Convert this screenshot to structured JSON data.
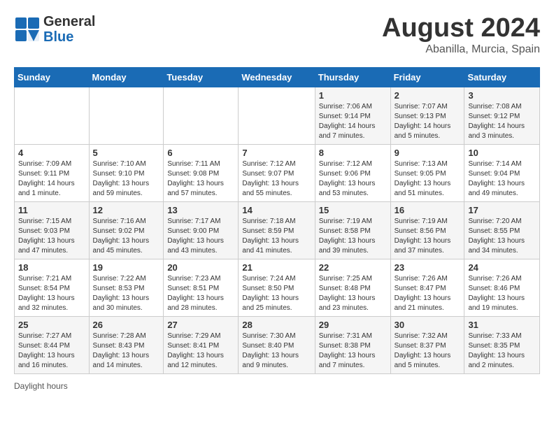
{
  "header": {
    "logo_general": "General",
    "logo_blue": "Blue",
    "month_year": "August 2024",
    "location": "Abanilla, Murcia, Spain"
  },
  "days_of_week": [
    "Sunday",
    "Monday",
    "Tuesday",
    "Wednesday",
    "Thursday",
    "Friday",
    "Saturday"
  ],
  "weeks": [
    [
      {
        "day": "",
        "sunrise": "",
        "sunset": "",
        "daylight": ""
      },
      {
        "day": "",
        "sunrise": "",
        "sunset": "",
        "daylight": ""
      },
      {
        "day": "",
        "sunrise": "",
        "sunset": "",
        "daylight": ""
      },
      {
        "day": "",
        "sunrise": "",
        "sunset": "",
        "daylight": ""
      },
      {
        "day": "1",
        "sunrise": "Sunrise: 7:06 AM",
        "sunset": "Sunset: 9:14 PM",
        "daylight": "Daylight: 14 hours and 7 minutes."
      },
      {
        "day": "2",
        "sunrise": "Sunrise: 7:07 AM",
        "sunset": "Sunset: 9:13 PM",
        "daylight": "Daylight: 14 hours and 5 minutes."
      },
      {
        "day": "3",
        "sunrise": "Sunrise: 7:08 AM",
        "sunset": "Sunset: 9:12 PM",
        "daylight": "Daylight: 14 hours and 3 minutes."
      }
    ],
    [
      {
        "day": "4",
        "sunrise": "Sunrise: 7:09 AM",
        "sunset": "Sunset: 9:11 PM",
        "daylight": "Daylight: 14 hours and 1 minute."
      },
      {
        "day": "5",
        "sunrise": "Sunrise: 7:10 AM",
        "sunset": "Sunset: 9:10 PM",
        "daylight": "Daylight: 13 hours and 59 minutes."
      },
      {
        "day": "6",
        "sunrise": "Sunrise: 7:11 AM",
        "sunset": "Sunset: 9:08 PM",
        "daylight": "Daylight: 13 hours and 57 minutes."
      },
      {
        "day": "7",
        "sunrise": "Sunrise: 7:12 AM",
        "sunset": "Sunset: 9:07 PM",
        "daylight": "Daylight: 13 hours and 55 minutes."
      },
      {
        "day": "8",
        "sunrise": "Sunrise: 7:12 AM",
        "sunset": "Sunset: 9:06 PM",
        "daylight": "Daylight: 13 hours and 53 minutes."
      },
      {
        "day": "9",
        "sunrise": "Sunrise: 7:13 AM",
        "sunset": "Sunset: 9:05 PM",
        "daylight": "Daylight: 13 hours and 51 minutes."
      },
      {
        "day": "10",
        "sunrise": "Sunrise: 7:14 AM",
        "sunset": "Sunset: 9:04 PM",
        "daylight": "Daylight: 13 hours and 49 minutes."
      }
    ],
    [
      {
        "day": "11",
        "sunrise": "Sunrise: 7:15 AM",
        "sunset": "Sunset: 9:03 PM",
        "daylight": "Daylight: 13 hours and 47 minutes."
      },
      {
        "day": "12",
        "sunrise": "Sunrise: 7:16 AM",
        "sunset": "Sunset: 9:02 PM",
        "daylight": "Daylight: 13 hours and 45 minutes."
      },
      {
        "day": "13",
        "sunrise": "Sunrise: 7:17 AM",
        "sunset": "Sunset: 9:00 PM",
        "daylight": "Daylight: 13 hours and 43 minutes."
      },
      {
        "day": "14",
        "sunrise": "Sunrise: 7:18 AM",
        "sunset": "Sunset: 8:59 PM",
        "daylight": "Daylight: 13 hours and 41 minutes."
      },
      {
        "day": "15",
        "sunrise": "Sunrise: 7:19 AM",
        "sunset": "Sunset: 8:58 PM",
        "daylight": "Daylight: 13 hours and 39 minutes."
      },
      {
        "day": "16",
        "sunrise": "Sunrise: 7:19 AM",
        "sunset": "Sunset: 8:56 PM",
        "daylight": "Daylight: 13 hours and 37 minutes."
      },
      {
        "day": "17",
        "sunrise": "Sunrise: 7:20 AM",
        "sunset": "Sunset: 8:55 PM",
        "daylight": "Daylight: 13 hours and 34 minutes."
      }
    ],
    [
      {
        "day": "18",
        "sunrise": "Sunrise: 7:21 AM",
        "sunset": "Sunset: 8:54 PM",
        "daylight": "Daylight: 13 hours and 32 minutes."
      },
      {
        "day": "19",
        "sunrise": "Sunrise: 7:22 AM",
        "sunset": "Sunset: 8:53 PM",
        "daylight": "Daylight: 13 hours and 30 minutes."
      },
      {
        "day": "20",
        "sunrise": "Sunrise: 7:23 AM",
        "sunset": "Sunset: 8:51 PM",
        "daylight": "Daylight: 13 hours and 28 minutes."
      },
      {
        "day": "21",
        "sunrise": "Sunrise: 7:24 AM",
        "sunset": "Sunset: 8:50 PM",
        "daylight": "Daylight: 13 hours and 25 minutes."
      },
      {
        "day": "22",
        "sunrise": "Sunrise: 7:25 AM",
        "sunset": "Sunset: 8:48 PM",
        "daylight": "Daylight: 13 hours and 23 minutes."
      },
      {
        "day": "23",
        "sunrise": "Sunrise: 7:26 AM",
        "sunset": "Sunset: 8:47 PM",
        "daylight": "Daylight: 13 hours and 21 minutes."
      },
      {
        "day": "24",
        "sunrise": "Sunrise: 7:26 AM",
        "sunset": "Sunset: 8:46 PM",
        "daylight": "Daylight: 13 hours and 19 minutes."
      }
    ],
    [
      {
        "day": "25",
        "sunrise": "Sunrise: 7:27 AM",
        "sunset": "Sunset: 8:44 PM",
        "daylight": "Daylight: 13 hours and 16 minutes."
      },
      {
        "day": "26",
        "sunrise": "Sunrise: 7:28 AM",
        "sunset": "Sunset: 8:43 PM",
        "daylight": "Daylight: 13 hours and 14 minutes."
      },
      {
        "day": "27",
        "sunrise": "Sunrise: 7:29 AM",
        "sunset": "Sunset: 8:41 PM",
        "daylight": "Daylight: 13 hours and 12 minutes."
      },
      {
        "day": "28",
        "sunrise": "Sunrise: 7:30 AM",
        "sunset": "Sunset: 8:40 PM",
        "daylight": "Daylight: 13 hours and 9 minutes."
      },
      {
        "day": "29",
        "sunrise": "Sunrise: 7:31 AM",
        "sunset": "Sunset: 8:38 PM",
        "daylight": "Daylight: 13 hours and 7 minutes."
      },
      {
        "day": "30",
        "sunrise": "Sunrise: 7:32 AM",
        "sunset": "Sunset: 8:37 PM",
        "daylight": "Daylight: 13 hours and 5 minutes."
      },
      {
        "day": "31",
        "sunrise": "Sunrise: 7:33 AM",
        "sunset": "Sunset: 8:35 PM",
        "daylight": "Daylight: 13 hours and 2 minutes."
      }
    ]
  ],
  "footer": {
    "daylight_hours_label": "Daylight hours"
  }
}
